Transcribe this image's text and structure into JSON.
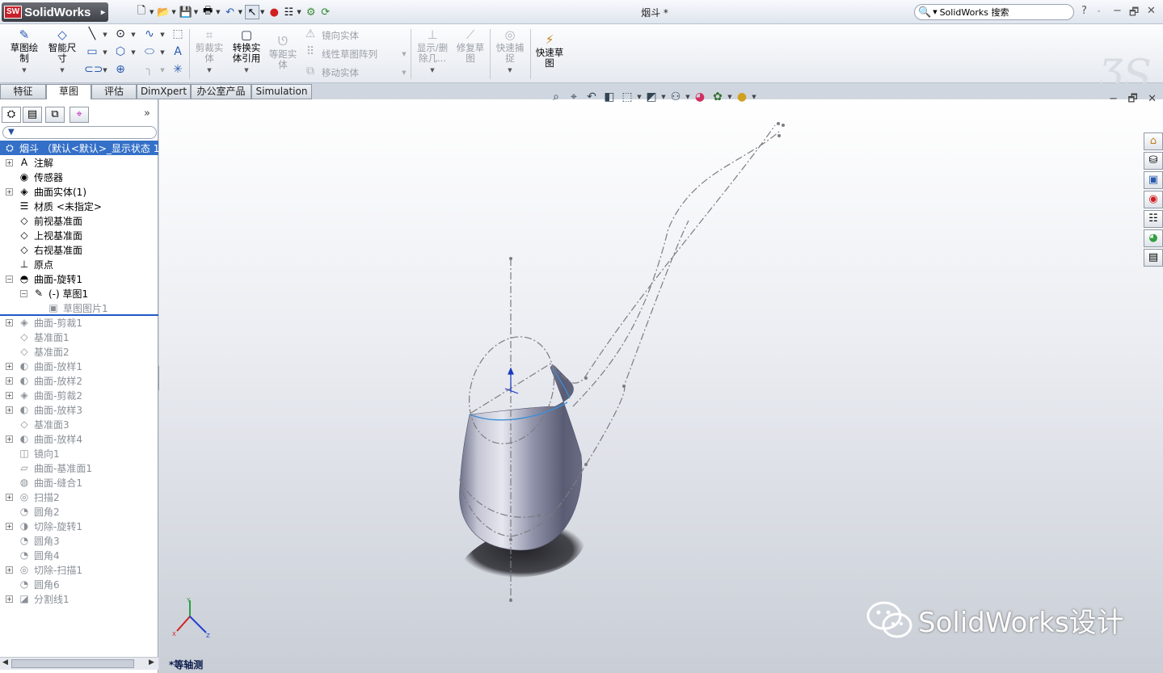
{
  "app": {
    "name": "SolidWorks",
    "badge": "SW",
    "doc_title": "烟斗 *"
  },
  "search": {
    "placeholder": "SolidWorks 搜索"
  },
  "title_controls": [
    "?",
    "-",
    "−",
    "🗗",
    "✕"
  ],
  "command_manager": {
    "sketch": "草图绘制",
    "smart_dim": "智能尺寸",
    "trim": "剪裁实体",
    "convert": "转换实体引用",
    "offset": "等距实体",
    "mirror": "镜向实体",
    "linear_pattern": "线性草图阵列",
    "move": "移动实体",
    "display_del": "显示/删除几...",
    "repair": "修复草图",
    "quick_snap": "快速捕捉",
    "rapid_sketch": "快速草图"
  },
  "tabs": [
    "特征",
    "草图",
    "评估",
    "DimXpert",
    "办公室产品",
    "Simulation"
  ],
  "active_tab": "草图",
  "tree": {
    "root": "烟斗 （默认<默认>_显示状态 1",
    "items": [
      {
        "label": "注解",
        "icon": "A",
        "exp": "+",
        "level": 0,
        "state": "normal"
      },
      {
        "label": "传感器",
        "icon": "◉",
        "exp": "",
        "level": 0,
        "state": "normal"
      },
      {
        "label": "曲面实体(1)",
        "icon": "◈",
        "exp": "+",
        "level": 0,
        "state": "normal"
      },
      {
        "label": "材质 <未指定>",
        "icon": "☰",
        "exp": "",
        "level": 0,
        "state": "normal"
      },
      {
        "label": "前视基准面",
        "icon": "◇",
        "exp": "",
        "level": 0,
        "state": "normal"
      },
      {
        "label": "上视基准面",
        "icon": "◇",
        "exp": "",
        "level": 0,
        "state": "normal"
      },
      {
        "label": "右视基准面",
        "icon": "◇",
        "exp": "",
        "level": 0,
        "state": "normal"
      },
      {
        "label": "原点",
        "icon": "⊥",
        "exp": "",
        "level": 0,
        "state": "normal"
      },
      {
        "label": "曲面-旋转1",
        "icon": "◓",
        "exp": "−",
        "level": 0,
        "state": "normal"
      },
      {
        "label": "(-) 草图1",
        "icon": "✎",
        "exp": "−",
        "level": 1,
        "state": "normal"
      },
      {
        "label": "草图图片1",
        "icon": "▣",
        "exp": "",
        "level": 2,
        "state": "grey"
      },
      {
        "label": "曲面-剪裁1",
        "icon": "◈",
        "exp": "+",
        "level": 0,
        "state": "grey"
      },
      {
        "label": "基准面1",
        "icon": "◇",
        "exp": "",
        "level": 0,
        "state": "grey"
      },
      {
        "label": "基准面2",
        "icon": "◇",
        "exp": "",
        "level": 0,
        "state": "grey"
      },
      {
        "label": "曲面-放样1",
        "icon": "◐",
        "exp": "+",
        "level": 0,
        "state": "grey"
      },
      {
        "label": "曲面-放样2",
        "icon": "◐",
        "exp": "+",
        "level": 0,
        "state": "grey"
      },
      {
        "label": "曲面-剪裁2",
        "icon": "◈",
        "exp": "+",
        "level": 0,
        "state": "grey"
      },
      {
        "label": "曲面-放样3",
        "icon": "◐",
        "exp": "+",
        "level": 0,
        "state": "grey"
      },
      {
        "label": "基准面3",
        "icon": "◇",
        "exp": "",
        "level": 0,
        "state": "grey"
      },
      {
        "label": "曲面-放样4",
        "icon": "◐",
        "exp": "+",
        "level": 0,
        "state": "grey"
      },
      {
        "label": "镜向1",
        "icon": "◫",
        "exp": "",
        "level": 0,
        "state": "grey"
      },
      {
        "label": "曲面-基准面1",
        "icon": "▱",
        "exp": "",
        "level": 0,
        "state": "grey"
      },
      {
        "label": "曲面-缝合1",
        "icon": "◍",
        "exp": "",
        "level": 0,
        "state": "grey"
      },
      {
        "label": "扫描2",
        "icon": "◎",
        "exp": "+",
        "level": 0,
        "state": "grey"
      },
      {
        "label": "圆角2",
        "icon": "◔",
        "exp": "",
        "level": 0,
        "state": "grey"
      },
      {
        "label": "切除-旋转1",
        "icon": "◑",
        "exp": "+",
        "level": 0,
        "state": "grey"
      },
      {
        "label": "圆角3",
        "icon": "◔",
        "exp": "",
        "level": 0,
        "state": "grey"
      },
      {
        "label": "圆角4",
        "icon": "◔",
        "exp": "",
        "level": 0,
        "state": "grey"
      },
      {
        "label": "切除-扫描1",
        "icon": "◎",
        "exp": "+",
        "level": 0,
        "state": "grey"
      },
      {
        "label": "圆角6",
        "icon": "◔",
        "exp": "",
        "level": 0,
        "state": "grey"
      },
      {
        "label": "分割线1",
        "icon": "◪",
        "exp": "+",
        "level": 0,
        "state": "grey"
      }
    ]
  },
  "viewport": {
    "view_name": "*等轴测"
  },
  "watermark": "SolidWorks设计",
  "colors": {
    "accent": "#3470c8",
    "brand": "#c8202a",
    "model": "#6a6e86"
  }
}
